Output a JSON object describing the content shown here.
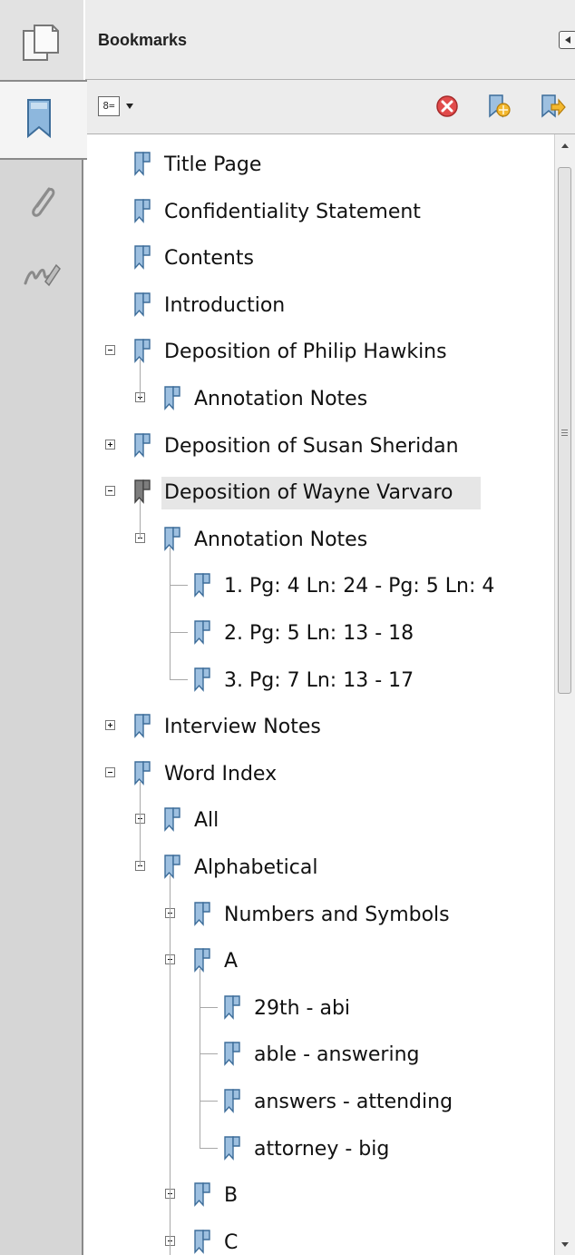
{
  "panel": {
    "title": "Bookmarks",
    "options_glyph": "8="
  },
  "rail": {
    "icons": [
      "pages-icon",
      "bookmarks-icon",
      "attachments-icon",
      "signatures-icon"
    ]
  },
  "toolbar": {
    "icons": [
      "delete-bookmark-icon",
      "new-bookmark-icon",
      "new-bookmark-from-structure-icon"
    ]
  },
  "bookmarks": [
    {
      "label": "Title Page",
      "level": 0,
      "toggle": "none"
    },
    {
      "label": "Confidentiality Statement",
      "level": 0,
      "toggle": "none"
    },
    {
      "label": "Contents",
      "level": 0,
      "toggle": "none"
    },
    {
      "label": "Introduction",
      "level": 0,
      "toggle": "none"
    },
    {
      "label": "Deposition of Philip Hawkins",
      "level": 0,
      "toggle": "minus"
    },
    {
      "label": "Annotation Notes",
      "level": 1,
      "toggle": "plus"
    },
    {
      "label": "Deposition of Susan Sheridan",
      "level": 0,
      "toggle": "plus"
    },
    {
      "label": "Deposition of Wayne Varvaro",
      "level": 0,
      "toggle": "minus",
      "selected": true
    },
    {
      "label": "Annotation Notes",
      "level": 1,
      "toggle": "minus"
    },
    {
      "label": "1. Pg: 4 Ln: 24 - Pg: 5 Ln: 4",
      "level": 2,
      "toggle": "none"
    },
    {
      "label": "2. Pg: 5 Ln: 13 - 18",
      "level": 2,
      "toggle": "none"
    },
    {
      "label": "3. Pg: 7 Ln: 13 - 17",
      "level": 2,
      "toggle": "none"
    },
    {
      "label": "Interview Notes",
      "level": 0,
      "toggle": "plus"
    },
    {
      "label": "Word Index",
      "level": 0,
      "toggle": "minus"
    },
    {
      "label": "All",
      "level": 1,
      "toggle": "plus"
    },
    {
      "label": "Alphabetical",
      "level": 1,
      "toggle": "minus"
    },
    {
      "label": "Numbers and Symbols",
      "level": 2,
      "toggle": "plus"
    },
    {
      "label": "A",
      "level": 2,
      "toggle": "minus"
    },
    {
      "label": "29th - abi",
      "level": 3,
      "toggle": "none"
    },
    {
      "label": "able - answering",
      "level": 3,
      "toggle": "none"
    },
    {
      "label": "answers - attending",
      "level": 3,
      "toggle": "none"
    },
    {
      "label": "attorney - big",
      "level": 3,
      "toggle": "none"
    },
    {
      "label": "B",
      "level": 2,
      "toggle": "plus"
    },
    {
      "label": "C",
      "level": 2,
      "toggle": "plus"
    }
  ]
}
